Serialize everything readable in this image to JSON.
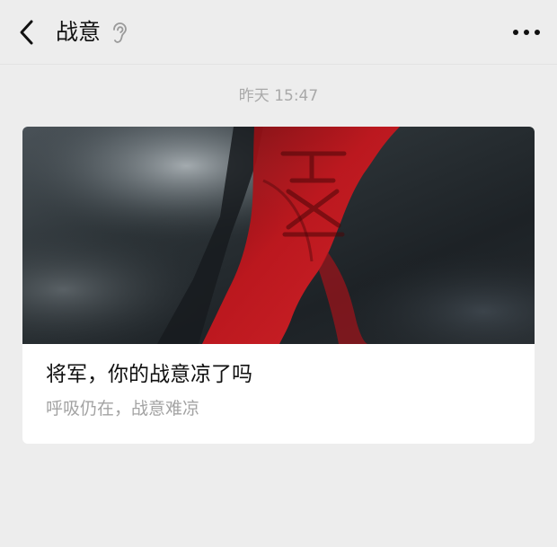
{
  "nav": {
    "title": "战意",
    "back_icon": "chevron-left-icon",
    "title_icon": "ear-icon",
    "more_icon": "more-dots-icon"
  },
  "chat": {
    "timestamp": "昨天 15:47"
  },
  "article": {
    "title": "将军，你的战意凉了吗",
    "digest": "呼吸仍在，战意难凉",
    "cover_description": "dark smoky sky with a red banner"
  },
  "colors": {
    "background": "#ededed",
    "card": "#ffffff",
    "title_text": "#111111",
    "secondary_text": "#a3a3a3",
    "banner_red": "#c8161d"
  }
}
